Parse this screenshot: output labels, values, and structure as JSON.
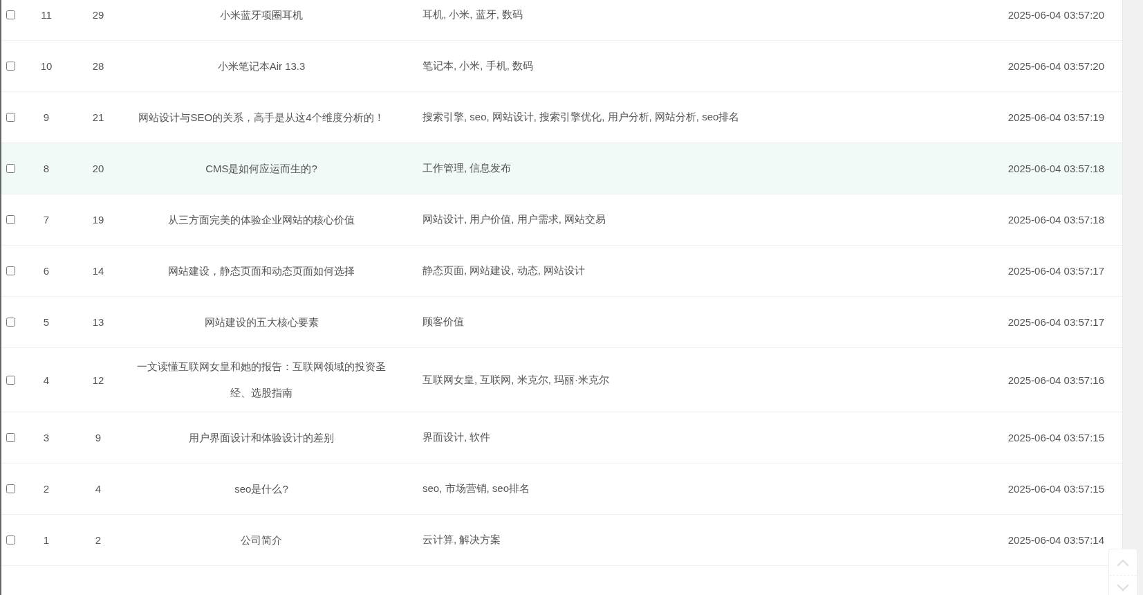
{
  "table": {
    "rows": [
      {
        "checked": false,
        "highlighted": false,
        "column_2": "11",
        "column_3": "29",
        "title": "小米蓝牙项圈耳机",
        "tags": "耳机, 小米, 蓝牙, 数码",
        "time": "2025-06-04 03:57:20"
      },
      {
        "checked": false,
        "highlighted": false,
        "column_2": "10",
        "column_3": "28",
        "title": "小米笔记本Air 13.3",
        "tags": "笔记本, 小米, 手机, 数码",
        "time": "2025-06-04 03:57:20"
      },
      {
        "checked": false,
        "highlighted": false,
        "column_2": "9",
        "column_3": "21",
        "title": "网站设计与SEO的关系，高手是从这4个维度分析的！",
        "tags": "搜索引擎, seo, 网站设计, 搜索引擎优化, 用户分析, 网站分析, seo排名",
        "time": "2025-06-04 03:57:19"
      },
      {
        "checked": false,
        "highlighted": true,
        "column_2": "8",
        "column_3": "20",
        "title": "CMS是如何应运而生的?",
        "tags": "工作管理, 信息发布",
        "time": "2025-06-04 03:57:18"
      },
      {
        "checked": false,
        "highlighted": false,
        "column_2": "7",
        "column_3": "19",
        "title": "从三方面完美的体验企业网站的核心价值",
        "tags": "网站设计, 用户价值, 用户需求, 网站交易",
        "time": "2025-06-04 03:57:18"
      },
      {
        "checked": false,
        "highlighted": false,
        "column_2": "6",
        "column_3": "14",
        "title": "网站建设，静态页面和动态页面如何选择",
        "tags": "静态页面, 网站建设, 动态, 网站设计",
        "time": "2025-06-04 03:57:17"
      },
      {
        "checked": false,
        "highlighted": false,
        "column_2": "5",
        "column_3": "13",
        "title": "网站建设的五大核心要素",
        "tags": "顾客价值",
        "time": "2025-06-04 03:57:17"
      },
      {
        "checked": false,
        "highlighted": false,
        "column_2": "4",
        "column_3": "12",
        "title": "一文读懂互联网女皇和她的报告：互联网领域的投资圣经、选股指南",
        "tags": "互联网女皇, 互联网, 米克尔, 玛丽·米克尔",
        "time": "2025-06-04 03:57:16"
      },
      {
        "checked": false,
        "highlighted": false,
        "column_2": "3",
        "column_3": "9",
        "title": "用户界面设计和体验设计的差别",
        "tags": "界面设计, 软件",
        "time": "2025-06-04 03:57:15"
      },
      {
        "checked": false,
        "highlighted": false,
        "column_2": "2",
        "column_3": "4",
        "title": "seo是什么?",
        "tags": "seo, 市场营销, seo排名",
        "time": "2025-06-04 03:57:15"
      },
      {
        "checked": false,
        "highlighted": false,
        "column_2": "1",
        "column_3": "2",
        "title": "公司简介",
        "tags": "云计算, 解决方案",
        "time": "2025-06-04 03:57:14"
      }
    ]
  }
}
